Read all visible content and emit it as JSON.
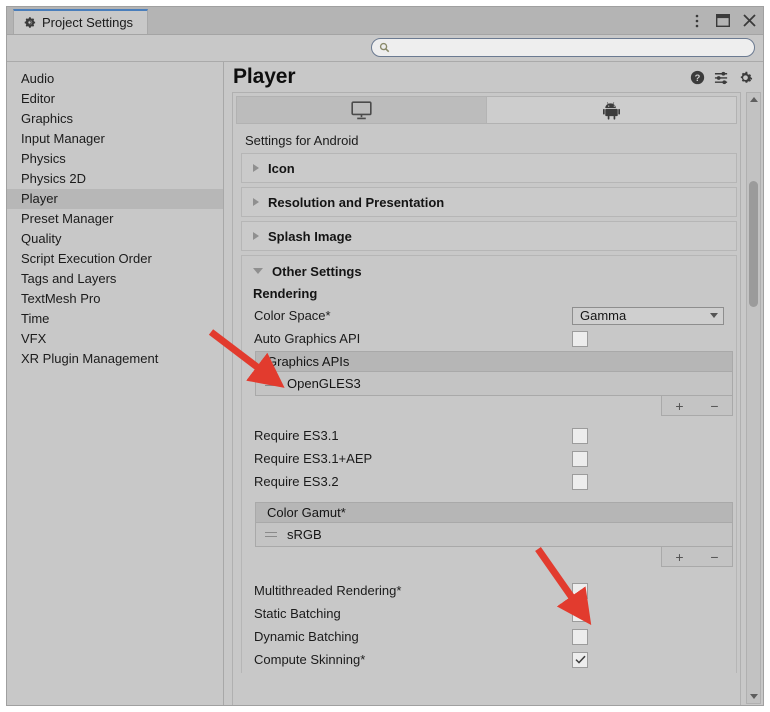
{
  "window": {
    "tab_title": "Project Settings",
    "tab_icon": "gear-icon",
    "controls": [
      {
        "name": "more-options-icon",
        "glyph": "⋮"
      },
      {
        "name": "window-layout-icon",
        "glyph": "▣"
      },
      {
        "name": "close-icon",
        "glyph": "✕"
      }
    ]
  },
  "search": {
    "placeholder": "",
    "value": "",
    "icon": "search-icon"
  },
  "sidebar": {
    "items": [
      {
        "label": "Audio",
        "selected": false
      },
      {
        "label": "Editor",
        "selected": false
      },
      {
        "label": "Graphics",
        "selected": false
      },
      {
        "label": "Input Manager",
        "selected": false
      },
      {
        "label": "Physics",
        "selected": false
      },
      {
        "label": "Physics 2D",
        "selected": false
      },
      {
        "label": "Player",
        "selected": true
      },
      {
        "label": "Preset Manager",
        "selected": false
      },
      {
        "label": "Quality",
        "selected": false
      },
      {
        "label": "Script Execution Order",
        "selected": false
      },
      {
        "label": "Tags and Layers",
        "selected": false
      },
      {
        "label": "TextMesh Pro",
        "selected": false
      },
      {
        "label": "Time",
        "selected": false
      },
      {
        "label": "VFX",
        "selected": false
      },
      {
        "label": "XR Plugin Management",
        "selected": false
      }
    ]
  },
  "main": {
    "title": "Player",
    "header_icons": [
      {
        "name": "help-icon",
        "glyph": "?"
      },
      {
        "name": "preset-icon",
        "glyph": "☲"
      },
      {
        "name": "gear-icon",
        "glyph": "⚙"
      }
    ],
    "platform_tabs": [
      {
        "name": "tab-standalone",
        "icon": "monitor-icon",
        "active": true
      },
      {
        "name": "tab-android",
        "icon": "android-icon",
        "active": false
      }
    ],
    "settings_for": "Settings for Android",
    "foldouts": [
      {
        "label": "Icon",
        "open": false
      },
      {
        "label": "Resolution and Presentation",
        "open": false
      },
      {
        "label": "Splash Image",
        "open": false
      }
    ],
    "other_settings": {
      "label": "Other Settings",
      "open": true,
      "rendering_header": "Rendering",
      "color_space": {
        "label": "Color Space*",
        "value": "Gamma",
        "control": "dropdown"
      },
      "auto_graphics_api": {
        "label": "Auto Graphics API",
        "checked": false
      },
      "graphics_apis": {
        "header": "Graphics APIs",
        "items": [
          "OpenGLES3"
        ],
        "add_label": "+",
        "remove_label": "−"
      },
      "requires": [
        {
          "label": "Require ES3.1",
          "checked": false
        },
        {
          "label": "Require ES3.1+AEP",
          "checked": false
        },
        {
          "label": "Require ES3.2",
          "checked": false
        }
      ],
      "color_gamut": {
        "header": "Color Gamut*",
        "items": [
          "sRGB"
        ],
        "add_label": "+",
        "remove_label": "−"
      },
      "batching": [
        {
          "label": "Multithreaded Rendering*",
          "checked": false
        },
        {
          "label": "Static Batching",
          "checked": true
        },
        {
          "label": "Dynamic Batching",
          "checked": false
        },
        {
          "label": "Compute Skinning*",
          "checked": true
        }
      ]
    }
  },
  "annotations": [
    {
      "name": "annotation-arrow-graphics-api",
      "color": "#e23b2e"
    },
    {
      "name": "annotation-arrow-multithreaded-rendering",
      "color": "#e23b2e"
    }
  ],
  "colors": {
    "accent": "#4a7ebb",
    "panel": "#c8c8c8",
    "selected_row": "#b7b7b7",
    "annotation": "#e23b2e"
  }
}
